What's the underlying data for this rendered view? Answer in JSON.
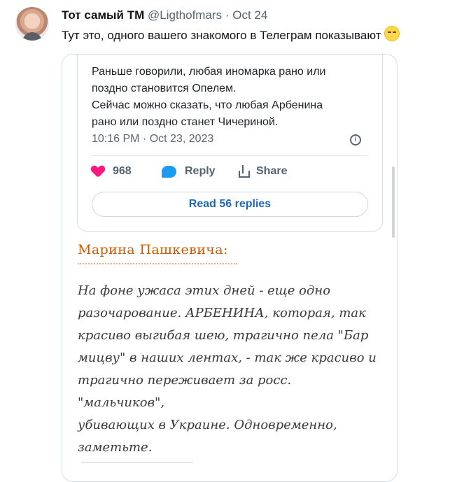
{
  "post": {
    "display_name": "Тот самый",
    "badge": "TM",
    "handle": "@Ligthofmars",
    "separator": "·",
    "date": "Oct 24",
    "text": "Тут это, одного вашего знакомого в Телеграм показывают",
    "emoji": "laughing-with-tears-emoji"
  },
  "embedded_tweet": {
    "text": "Раньше говорили, любая иномарка рано или\nпоздно становится Опелем.\nСейчас можно сказать, что любая Арбенина\nрано или поздно станет Чичериной.",
    "timestamp": "10:16 PM · Oct 23, 2023",
    "likes": "968",
    "reply_label": "Reply",
    "share_label": "Share",
    "read_replies_label": "Read 56 replies",
    "colors": {
      "heart": "#f91880",
      "reply": "#1d9bf0",
      "button_text": "#1d66b7"
    }
  },
  "quote": {
    "author": "Марина Пашкевича:",
    "body": "На фоне ужаса этих дней - еще одно\nразочарование. АРБЕНИНА, которая, так\nкрасиво выгибая шею, трагично пела \"Бар\nмицву\" в наших лентах, - так же красиво и\nтрагично переживает за росс. \"мальчиков\",\nубивающих в Украине. Одновременно,\nзаметьте.",
    "accent_color": "#cc5b00"
  }
}
